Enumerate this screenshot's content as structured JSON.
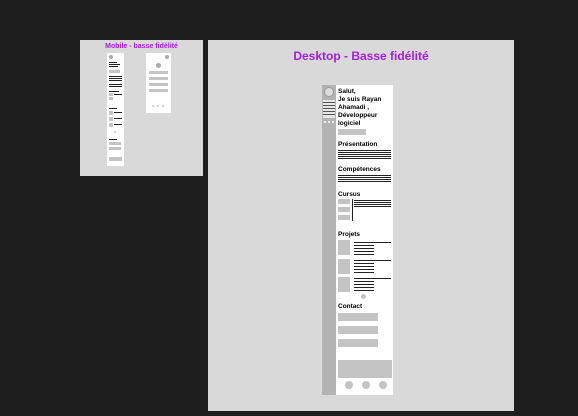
{
  "frames": {
    "mobile": {
      "title": "Mobile - basse fidélité"
    },
    "desktop": {
      "title": "Desktop - Basse fidélité"
    }
  },
  "wireframe": {
    "greeting_lines": [
      "Salut,",
      "Je suis Rayan",
      "Ahamadi ,",
      "Développeur",
      "logiciel"
    ],
    "sections": {
      "presentation": "Présentation",
      "competences": "Compétences",
      "cursus": "Cursus",
      "projets": "Projets",
      "contact": "Contact"
    }
  }
}
